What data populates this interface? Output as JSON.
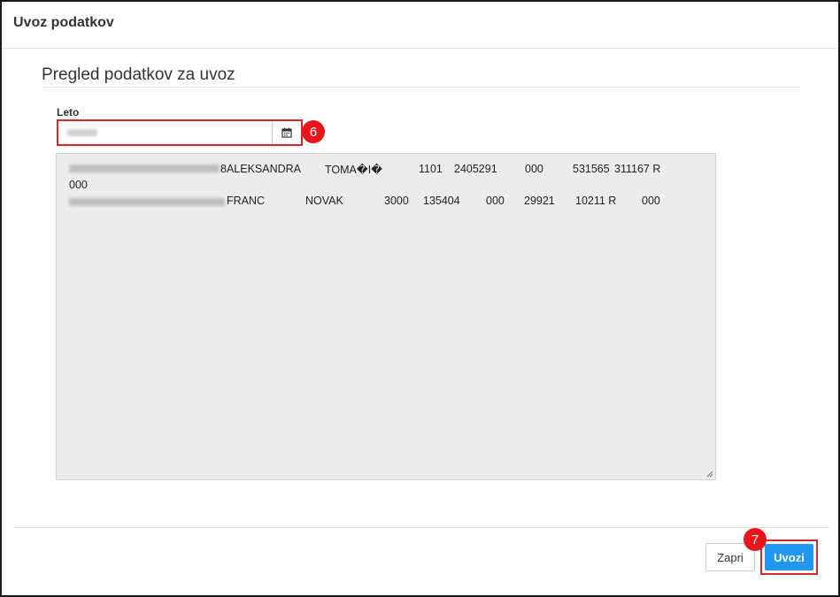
{
  "dialog": {
    "title": "Uvoz podatkov",
    "section_title": "Pregled podatkov za uvoz",
    "field_label": "Leto",
    "calendar_icon": "calendar-icon",
    "markers": {
      "year": "6",
      "import": "7"
    },
    "preview": {
      "rows": [
        {
          "cells": [
            "8ALEKSANDRA",
            "TOMA�I�",
            "1101",
            "2405291",
            "000",
            "531565",
            "311167 R"
          ]
        },
        {
          "cells": [
            "000"
          ]
        },
        {
          "cells": [
            "FRANC",
            "NOVAK",
            "3000",
            "135404",
            "000",
            "29921",
            "10211 R",
            "000"
          ]
        }
      ]
    },
    "buttons": {
      "close": "Zapri",
      "import": "Uvozi"
    },
    "colors": {
      "primary": "#2196f3",
      "highlight": "#d9262b",
      "textarea_bg": "#ececec"
    }
  }
}
